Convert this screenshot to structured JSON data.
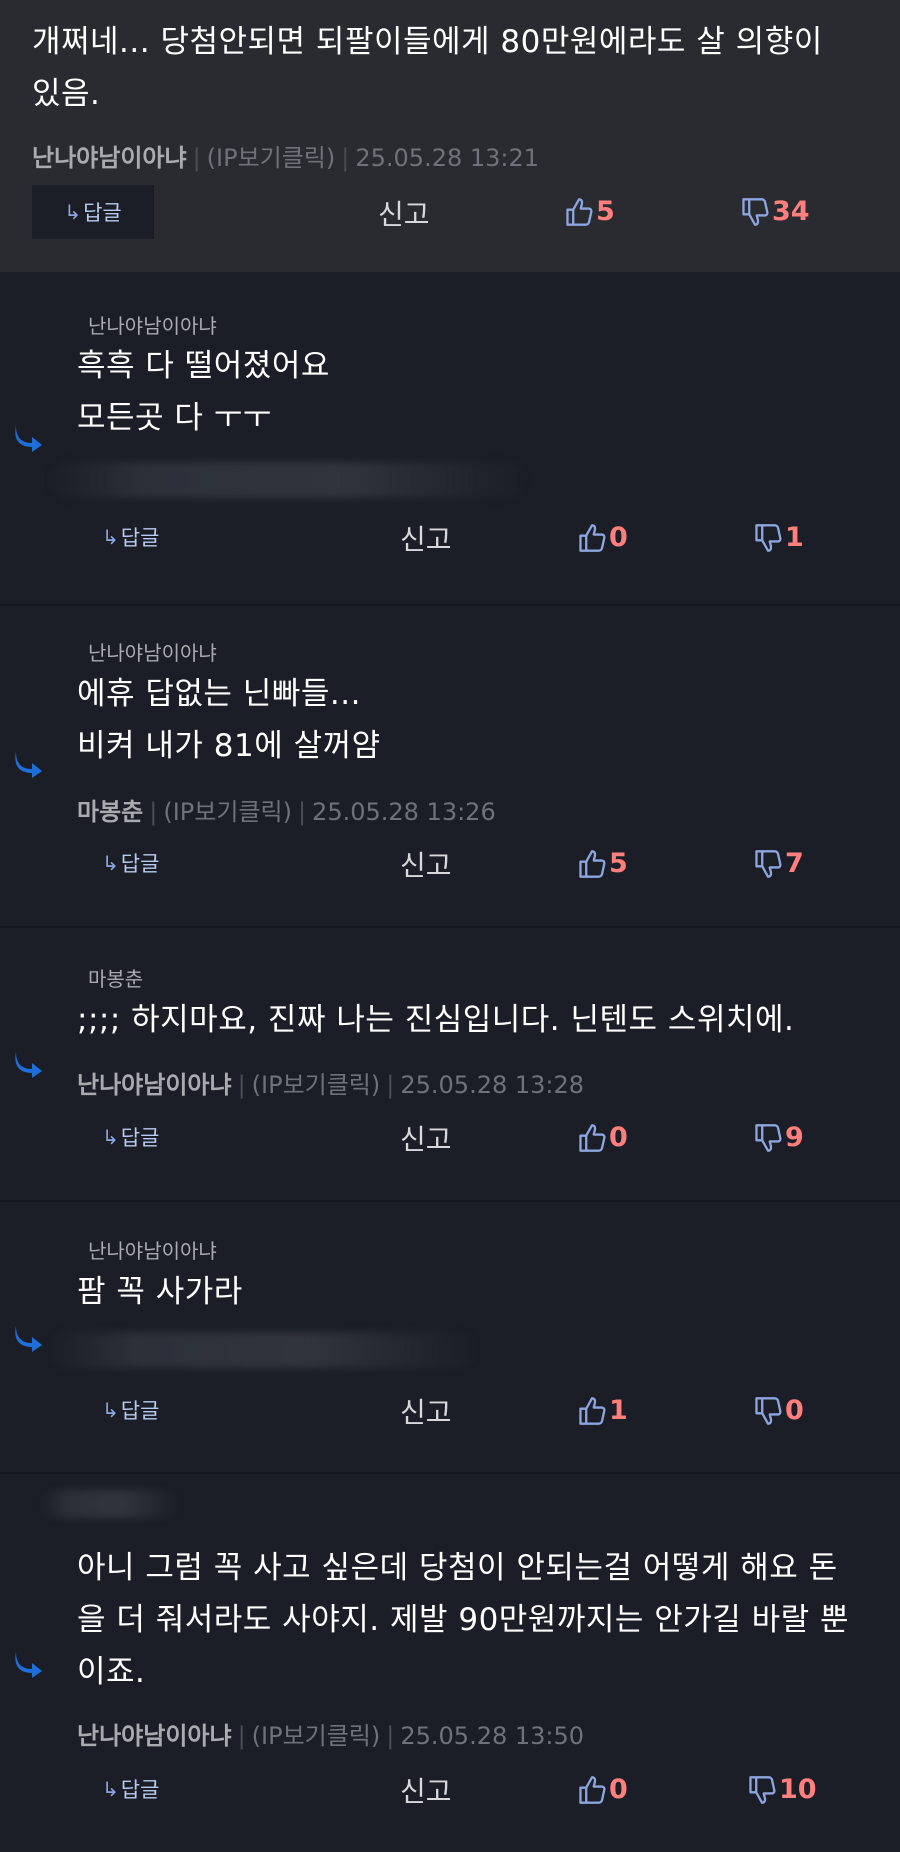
{
  "top_comment": {
    "text_line1": "개쩌네... 당첨안되면 되팔이들에게 80만원에라도 살 의향이",
    "text_line2": "있음.",
    "author": "난나야남이아냐",
    "ip": "(IP보기클릭)",
    "date": "25.05.28 13:21",
    "reply_label": "답글",
    "report_label": "신고",
    "likes": "5",
    "dislikes": "34"
  },
  "replies": [
    {
      "mention": "난나야남이아냐",
      "line1": "흑흑 다 떨어졌어요",
      "line2": "모든곳 다 ㅜㅜ",
      "reply_label": "답글",
      "report_label": "신고",
      "likes": "0",
      "dislikes": "1"
    },
    {
      "mention": "난나야남이아냐",
      "line1": "에휴 답없는 닌빠들...",
      "line2": "비켜 내가 81에 살꺼얌",
      "author": "마봉춘",
      "ip": "(IP보기클릭)",
      "date": "25.05.28 13:26",
      "reply_label": "답글",
      "report_label": "신고",
      "likes": "5",
      "dislikes": "7"
    },
    {
      "mention": "마봉춘",
      "line1": ";;;; 하지마요, 진짜 나는 진심입니다. 닌텐도 스위치에.",
      "author": "난나야남이아냐",
      "ip": "(IP보기클릭)",
      "date": "25.05.28 13:28",
      "reply_label": "답글",
      "report_label": "신고",
      "likes": "0",
      "dislikes": "9"
    },
    {
      "mention": "난나야남이아냐",
      "line1": "팜 꼭 사가라",
      "reply_label": "답글",
      "report_label": "신고",
      "likes": "1",
      "dislikes": "0"
    },
    {
      "line1": "아니 그럼 꼭 사고 싶은데 당첨이 안되는걸 어떻게 해요 돈",
      "line2": "을 더 줘서라도 사야지. 제발 90만원까지는 안가길 바랄 뿐",
      "line3": "이죠.",
      "author": "난나야남이아냐",
      "ip": "(IP보기클릭)",
      "date": "25.05.28 13:50",
      "reply_label": "답글",
      "report_label": "신고",
      "likes": "0",
      "dislikes": "10"
    }
  ],
  "colors": {
    "background": "#1b1e26",
    "top_background": "#2a2b30",
    "dislike": "#ff7e7e",
    "like_icon": "#8ea6e0",
    "reply_arrow": "#1e6fd9"
  }
}
